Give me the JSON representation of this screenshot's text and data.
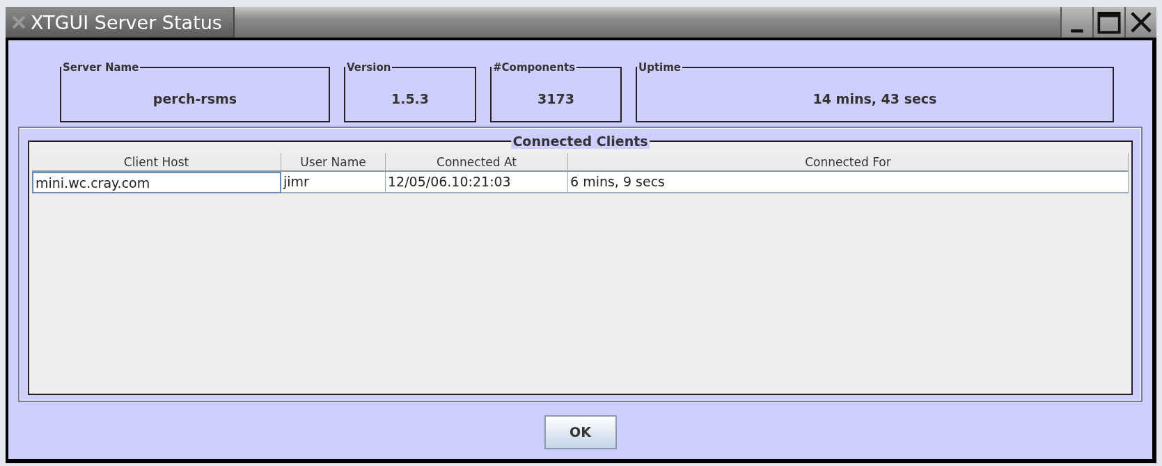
{
  "window": {
    "title": "XTGUI Server Status"
  },
  "info_boxes": [
    {
      "label": "Server Name",
      "value": "perch-rsms"
    },
    {
      "label": "Version",
      "value": "1.5.3"
    },
    {
      "label": "#Components",
      "value": "3173"
    },
    {
      "label": "Uptime",
      "value": "14 mins, 43 secs"
    }
  ],
  "clients": {
    "title": "Connected Clients",
    "columns": [
      "Client Host",
      "User Name",
      "Connected At",
      "Connected For"
    ],
    "rows": [
      {
        "cells": [
          {
            "text": "mini.wc.cray.com",
            "focused": true
          },
          {
            "text": "jimr",
            "focused": false
          },
          {
            "text": "12/05/06.10:21:03",
            "focused": false
          },
          {
            "text": "6 mins, 9 secs",
            "focused": false
          }
        ]
      }
    ]
  },
  "buttons": [
    {
      "label": "OK"
    }
  ]
}
